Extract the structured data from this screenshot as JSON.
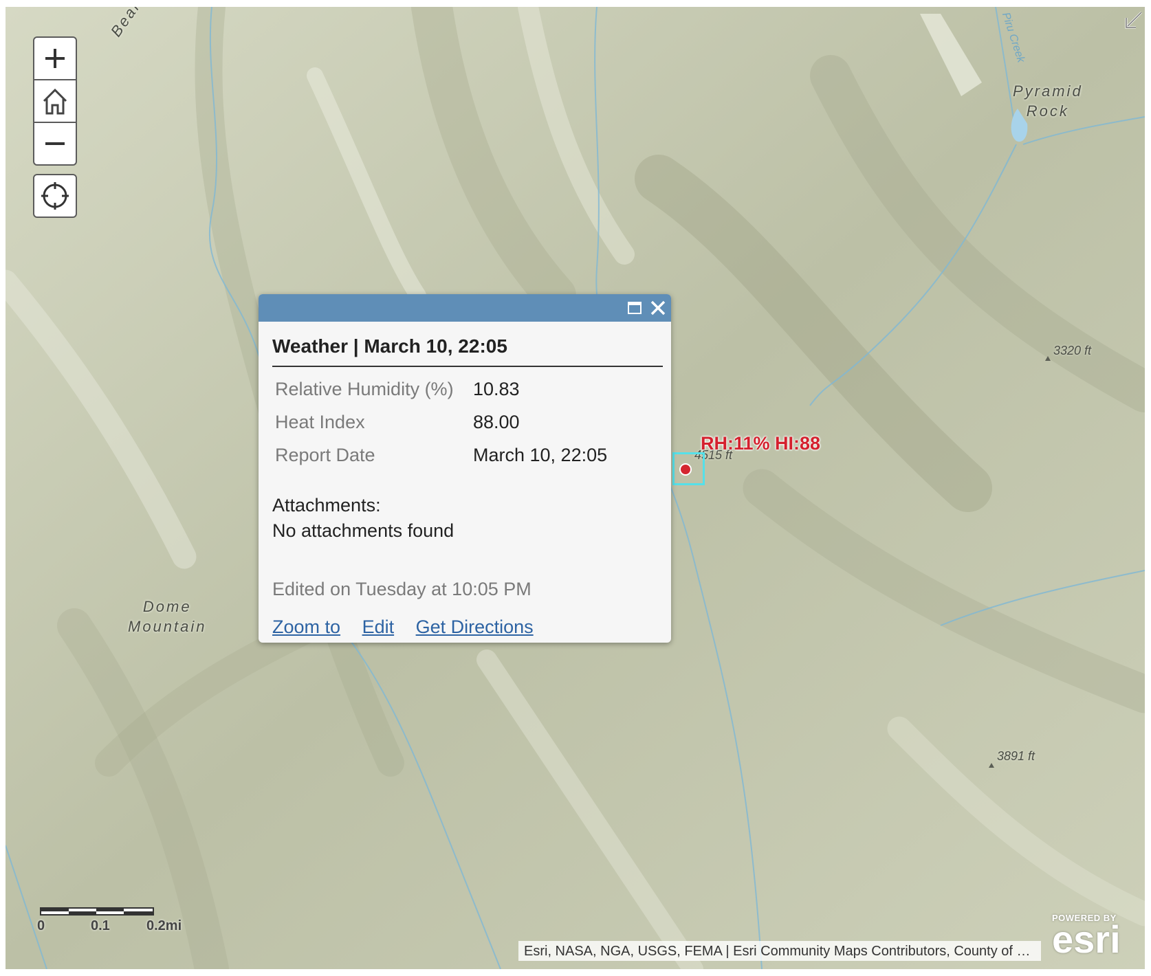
{
  "map": {
    "places": [
      {
        "id": "pyramid-rock",
        "lines": [
          "Pyramid",
          "Rock"
        ]
      },
      {
        "id": "dome-mountain",
        "lines": [
          "Dome",
          "Mountain"
        ]
      }
    ],
    "partial_label": "Beart",
    "creek_label": "Piru Creek",
    "elevations": [
      "3320 ft",
      "3891 ft",
      "4515 ft"
    ]
  },
  "controls": {
    "zoom_in": "plus-icon",
    "home": "home-icon",
    "zoom_out": "minus-icon",
    "locate": "locate-crosshair-icon",
    "expand": "expand-icon"
  },
  "popup": {
    "title": "Weather | March 10, 22:05",
    "fields": [
      {
        "label": "Relative Humidity (%)",
        "value": "10.83"
      },
      {
        "label": "Heat Index",
        "value": "88.00"
      },
      {
        "label": "Report Date",
        "value": "March 10, 22:05"
      }
    ],
    "attachments_label": "Attachments:",
    "attachments_value": "No attachments found",
    "edited": "Edited on Tuesday at 10:05 PM",
    "actions": {
      "zoom": "Zoom to",
      "edit": "Edit",
      "directions": "Get Directions"
    }
  },
  "feature": {
    "label": "RH:11% HI:88",
    "color": "#d4212e",
    "highlight": "#55e0e9"
  },
  "scale": {
    "labels": [
      "0",
      "0.1",
      "0.2mi"
    ]
  },
  "attribution": "Esri, NASA, NGA, USGS, FEMA | Esri Community Maps Contributors, County of …",
  "logo": {
    "powered": "POWERED BY",
    "word": "esri"
  },
  "colors": {
    "popup_header": "#5f8eb7",
    "link": "#2d63a3",
    "terrain": "#c4c8b0",
    "water": "#6fa7c6"
  }
}
